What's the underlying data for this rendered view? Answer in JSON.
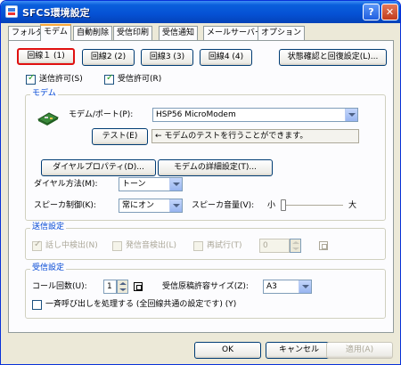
{
  "window": {
    "title": "SFCS環境設定",
    "help_glyph": "?",
    "close_glyph": "✕"
  },
  "tabs": [
    "フォルダ",
    "モデム",
    "自動削除",
    "受信印刷",
    "受信通知",
    "メールサーバー",
    "オプション"
  ],
  "line_buttons": [
    "回線１ (1)",
    "回線2 (2)",
    "回線3 (3)",
    "回線4 (4)"
  ],
  "status_button": "状態確認と回復設定(L)...",
  "permissions": {
    "send": "送信許可(S)",
    "receive": "受信許可(R)"
  },
  "modem": {
    "group": "モデム",
    "port_label": "モデム/ポート(P):",
    "port_value": "HSP56 MicroModem",
    "test_button": "テスト(E)",
    "test_hint": "← モデムのテストを行うことができます。",
    "dial_props_button": "ダイヤルプロパティ(D)...",
    "detail_button": "モデムの詳細設定(T)...",
    "dial_method_label": "ダイヤル方法(M):",
    "dial_method_value": "トーン",
    "speaker_label": "スピーカ制御(K):",
    "speaker_value": "常にオン",
    "volume_label": "スピーカ音量(V):",
    "volume_low": "小",
    "volume_high": "大",
    "volume_level": 0
  },
  "send": {
    "group": "送信設定",
    "busy_detect": "話し中検出(N)",
    "tone_detect": "発信音検出(L)",
    "retry": "再試行(T)",
    "retry_value": "0"
  },
  "receive": {
    "group": "受信設定",
    "call_count_label": "コール回数(U):",
    "call_count_value": "1",
    "size_label": "受信原稿許容サイズ(Z):",
    "size_value": "A3",
    "bulk_call": "一斉呼び出しを処理する (全回線共通の設定です) (Y)"
  },
  "footer": {
    "ok": "OK",
    "cancel": "キャンセル",
    "apply": "適用(A)"
  }
}
